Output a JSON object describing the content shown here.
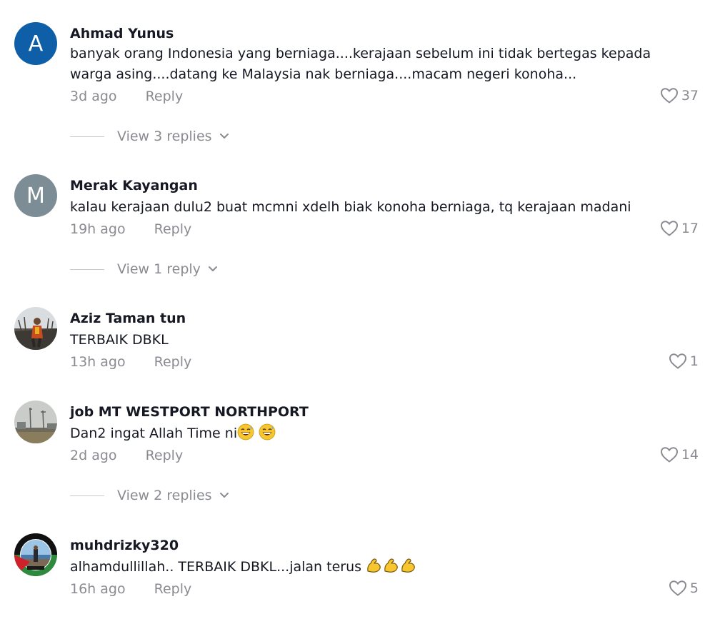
{
  "comments": [
    {
      "avatar_letter": "A",
      "avatar_color": "#0f5fa8",
      "username": "Ahmad Yunus",
      "text_line1": "banyak orang Indonesia yang berniaga....kerajaan sebelum ini tidak bertegas kepada",
      "text_line2": "warga asing....datang ke Malaysia nak berniaga....macam negeri konoha...",
      "time": "3d ago",
      "reply_label": "Reply",
      "likes": "37",
      "view_replies": "View 3 replies"
    },
    {
      "avatar_letter": "M",
      "avatar_color": "#7c8d96",
      "username": "Merak Kayangan",
      "text": "kalau kerajaan dulu2 buat mcmni xdelh biak konoha berniaga, tq kerajaan madani",
      "time": "19h ago",
      "reply_label": "Reply",
      "likes": "17",
      "view_replies": "View 1 reply"
    },
    {
      "avatar_icon": "profile-photo-outdoor",
      "username": "Aziz Taman tun",
      "text": "TERBAIK DBKL",
      "time": "13h ago",
      "reply_label": "Reply",
      "likes": "1"
    },
    {
      "avatar_icon": "profile-photo-port",
      "username": "job MT WESTPORT NORTHPORT",
      "text": "Dan2 ingat Allah Time ni",
      "emoji": "grinning-sweat-emoji",
      "time": "2d ago",
      "reply_label": "Reply",
      "likes": "14",
      "view_replies": "View 2 replies"
    },
    {
      "avatar_icon": "profile-photo-palestine-frame",
      "username": "muhdrizky320",
      "text": "alhamdullillah.. TERBAIK DBKL...jalan terus",
      "emoji": "flexed-biceps-emoji",
      "time": "16h ago",
      "reply_label": "Reply",
      "likes": "5"
    }
  ]
}
